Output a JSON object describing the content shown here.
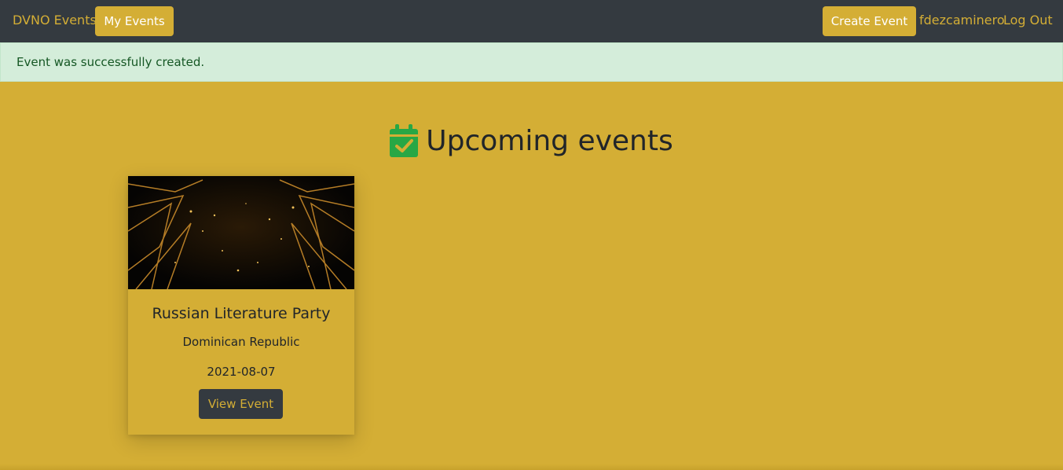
{
  "navbar": {
    "brand": "DVNO Events",
    "my_events_label": "My Events",
    "create_event_label": "Create Event",
    "username": "fdezcaminero",
    "logout_label": "Log Out"
  },
  "alert": {
    "message": "Event was successfully created."
  },
  "main": {
    "heading": "Upcoming events",
    "heading_icon": "calendar-check-icon",
    "events": [
      {
        "title": "Russian Literature Party",
        "location": "Dominican Republic",
        "date": "2021-08-07",
        "button_label": "View Event"
      }
    ]
  },
  "colors": {
    "background": "#d4ae35",
    "navbar": "#343a40",
    "alert_bg": "#d4edda",
    "alert_text": "#155724",
    "icon_green": "#28a745"
  }
}
